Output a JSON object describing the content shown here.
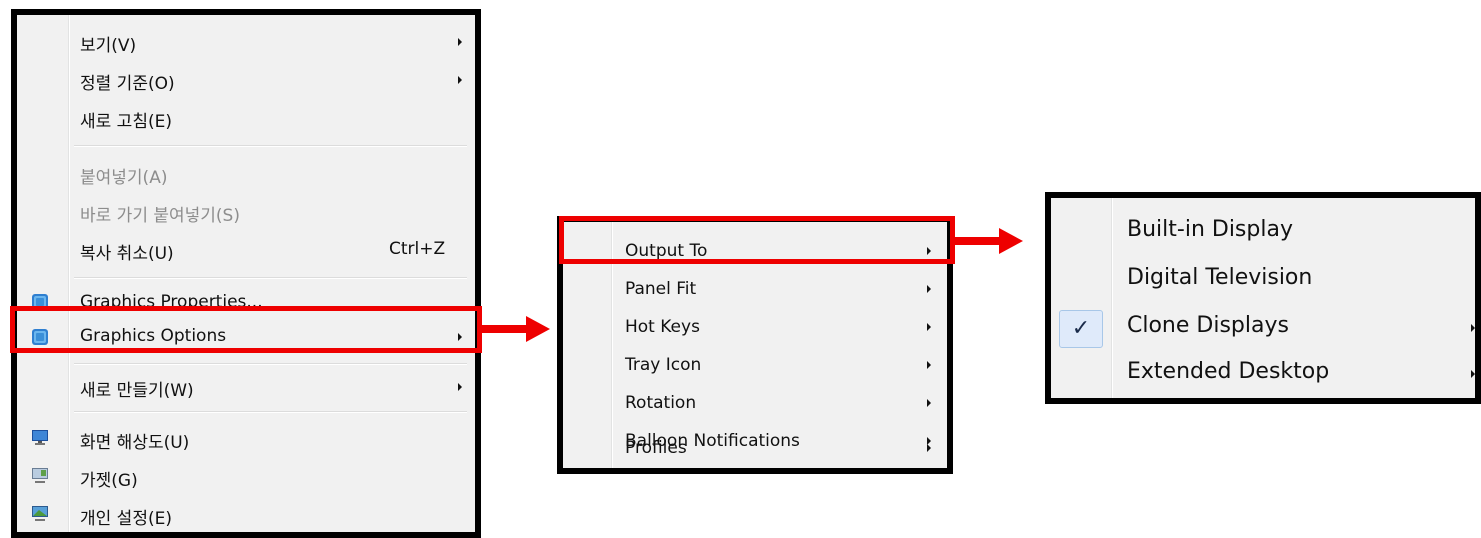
{
  "context_menu": {
    "items": [
      {
        "label": "보기(V)",
        "has_submenu": true
      },
      {
        "label": "정렬 기준(O)",
        "has_submenu": true
      },
      {
        "label": "새로 고침(E)"
      },
      {
        "label": "붙여넣기(A)",
        "disabled": true
      },
      {
        "label": "바로 가기 붙여넣기(S)",
        "disabled": true
      },
      {
        "label": "복사 취소(U)",
        "shortcut": "Ctrl+Z"
      },
      {
        "label": "Graphics Properties...",
        "icon": "graphics-properties-icon"
      },
      {
        "label": "Graphics Options",
        "icon": "graphics-options-icon",
        "has_submenu": true,
        "highlighted": true
      },
      {
        "label": "새로 만들기(W)",
        "has_submenu": true
      },
      {
        "label": "화면 해상도(U)",
        "icon": "screen-resolution-icon"
      },
      {
        "label": "가젯(G)",
        "icon": "gadgets-icon"
      },
      {
        "label": "개인 설정(E)",
        "icon": "personalize-icon"
      }
    ]
  },
  "graphics_options_submenu": {
    "items": [
      {
        "label": "Output To",
        "has_submenu": true,
        "highlighted": true
      },
      {
        "label": "Panel Fit",
        "has_submenu": true
      },
      {
        "label": "Hot Keys",
        "has_submenu": true
      },
      {
        "label": "Tray Icon",
        "has_submenu": true
      },
      {
        "label": "Rotation",
        "has_submenu": true
      },
      {
        "label": "Balloon Notifications",
        "has_submenu": true
      },
      {
        "label": "Profiles",
        "has_submenu": true
      }
    ]
  },
  "output_to_submenu": {
    "items": [
      {
        "label": "Built-in Display"
      },
      {
        "label": "Digital Television"
      },
      {
        "label": "Clone Displays",
        "checked": true,
        "check_glyph": "✓",
        "has_submenu": true
      },
      {
        "label": "Extended Desktop",
        "has_submenu": true
      }
    ]
  },
  "colors": {
    "highlight_border": "#ee0000",
    "menu_border": "#000000",
    "menu_background": "#f1f1f1",
    "disabled_text": "#8d8d8d"
  }
}
